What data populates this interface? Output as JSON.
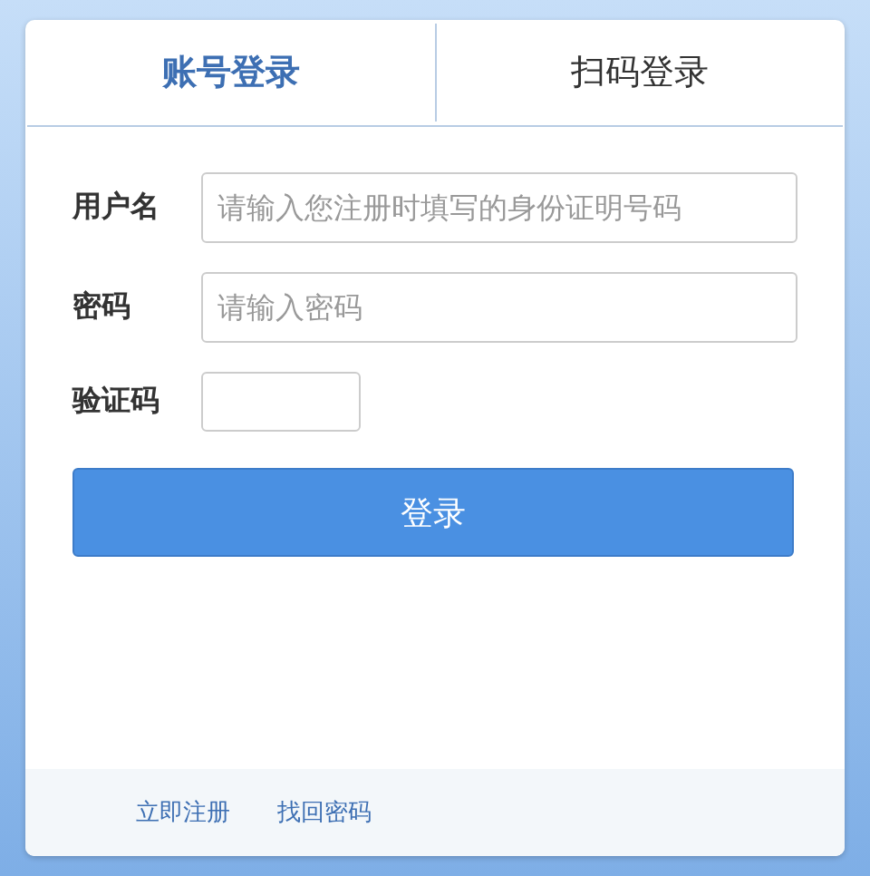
{
  "tabs": [
    {
      "label": "账号登录",
      "selected": true
    },
    {
      "label": "扫码登录",
      "selected": false
    }
  ],
  "fields": [
    {
      "label": "用户名",
      "placeholder": "请输入您注册时填写的身份证明号码",
      "kind": "wide"
    },
    {
      "label": "密码",
      "placeholder": "请输入密码",
      "kind": "wide"
    },
    {
      "label": "验证码",
      "kind": "short"
    }
  ],
  "submit": "登录",
  "footer_links": [
    "立即注册",
    "找回密码"
  ]
}
